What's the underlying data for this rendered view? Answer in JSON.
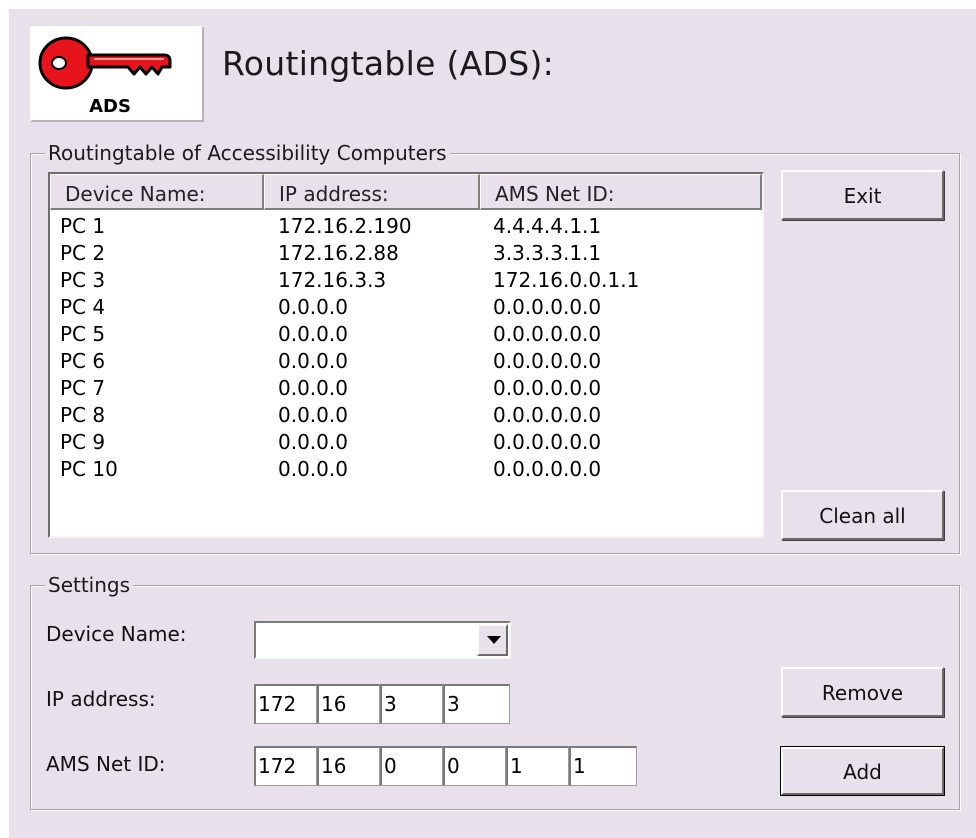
{
  "header": {
    "logo_text": "ADS",
    "title": "Routingtable (ADS):"
  },
  "routing_group": {
    "legend": "Routingtable of Accessibility Computers",
    "columns": [
      "Device Name:",
      "IP address:",
      "AMS Net ID:"
    ],
    "rows": [
      {
        "name": "PC 1",
        "ip": "172.16.2.190",
        "ams": "4.4.4.4.1.1"
      },
      {
        "name": "PC 2",
        "ip": "172.16.2.88",
        "ams": "3.3.3.3.1.1"
      },
      {
        "name": "PC 3",
        "ip": "172.16.3.3",
        "ams": "172.16.0.0.1.1"
      },
      {
        "name": "PC 4",
        "ip": "0.0.0.0",
        "ams": "0.0.0.0.0.0"
      },
      {
        "name": "PC 5",
        "ip": "0.0.0.0",
        "ams": "0.0.0.0.0.0"
      },
      {
        "name": "PC 6",
        "ip": "0.0.0.0",
        "ams": "0.0.0.0.0.0"
      },
      {
        "name": "PC 7",
        "ip": "0.0.0.0",
        "ams": "0.0.0.0.0.0"
      },
      {
        "name": "PC 8",
        "ip": "0.0.0.0",
        "ams": "0.0.0.0.0.0"
      },
      {
        "name": "PC 9",
        "ip": "0.0.0.0",
        "ams": "0.0.0.0.0.0"
      },
      {
        "name": "PC 10",
        "ip": "0.0.0.0",
        "ams": "0.0.0.0.0.0"
      }
    ],
    "exit_label": "Exit",
    "clean_all_label": "Clean all"
  },
  "settings": {
    "legend": "Settings",
    "device_name_label": "Device Name:",
    "device_name_value": "",
    "ip_label": "IP address:",
    "ip_octets": [
      "172",
      "16",
      "3",
      "3"
    ],
    "ams_label": "AMS Net ID:",
    "ams_octets": [
      "172",
      "16",
      "0",
      "0",
      "1",
      "1"
    ],
    "remove_label": "Remove",
    "add_label": "Add"
  }
}
